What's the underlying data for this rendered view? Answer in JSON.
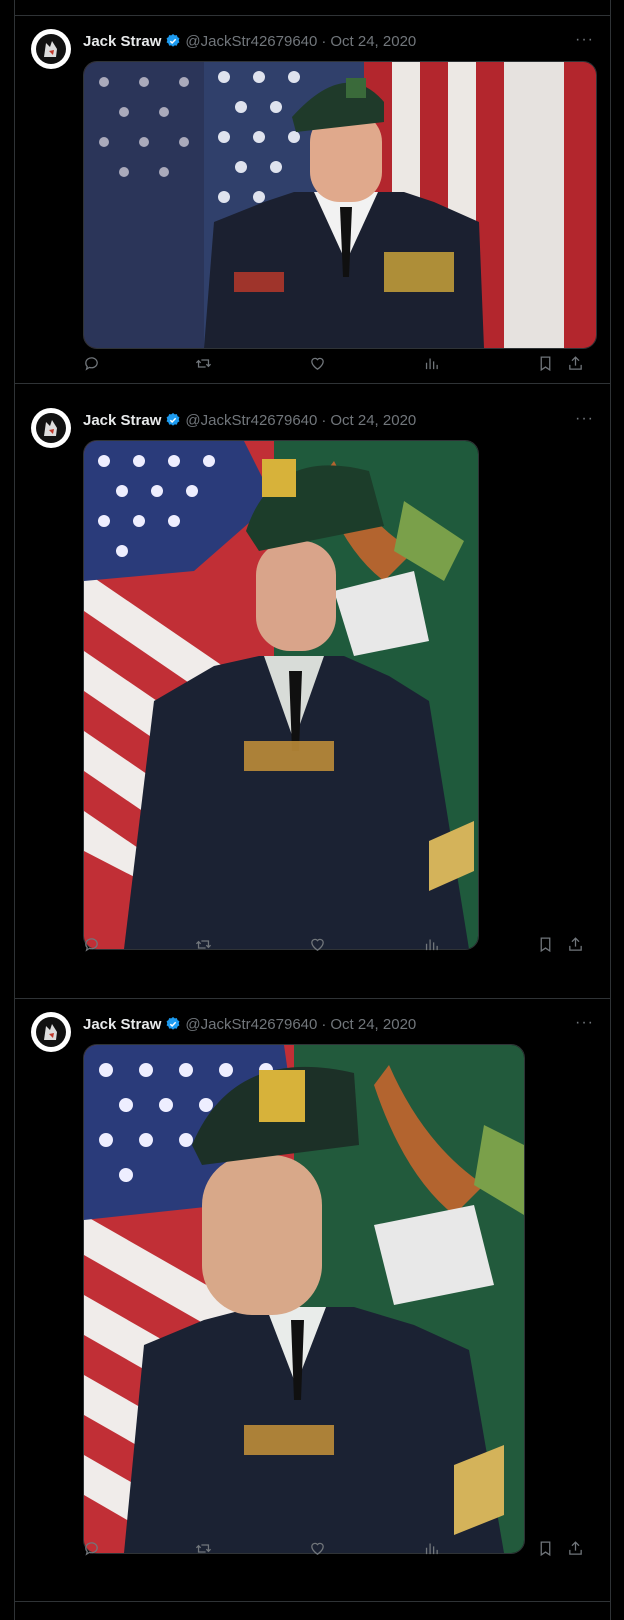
{
  "tweets": [
    {
      "author": {
        "name": "Jack Straw",
        "handle": "@JackStr42679640",
        "verified": true
      },
      "separator": "·",
      "date": "Oct 24, 2020",
      "more": "···",
      "media_description_icon": "photo"
    },
    {
      "author": {
        "name": "Jack Straw",
        "handle": "@JackStr42679640",
        "verified": true
      },
      "separator": "·",
      "date": "Oct 24, 2020",
      "more": "···",
      "media_description_icon": "photo"
    },
    {
      "author": {
        "name": "Jack Straw",
        "handle": "@JackStr42679640",
        "verified": true
      },
      "separator": "·",
      "date": "Oct 24, 2020",
      "more": "···",
      "media_description_icon": "photo"
    }
  ],
  "colors": {
    "background": "#000000",
    "border": "#2f3336",
    "muted": "#71767b",
    "verified": "#1d9bf0",
    "text": "#e7e9ea"
  },
  "action_icons": [
    "reply-icon",
    "retweet-icon",
    "like-icon",
    "views-icon",
    "bookmark-icon",
    "share-icon"
  ]
}
